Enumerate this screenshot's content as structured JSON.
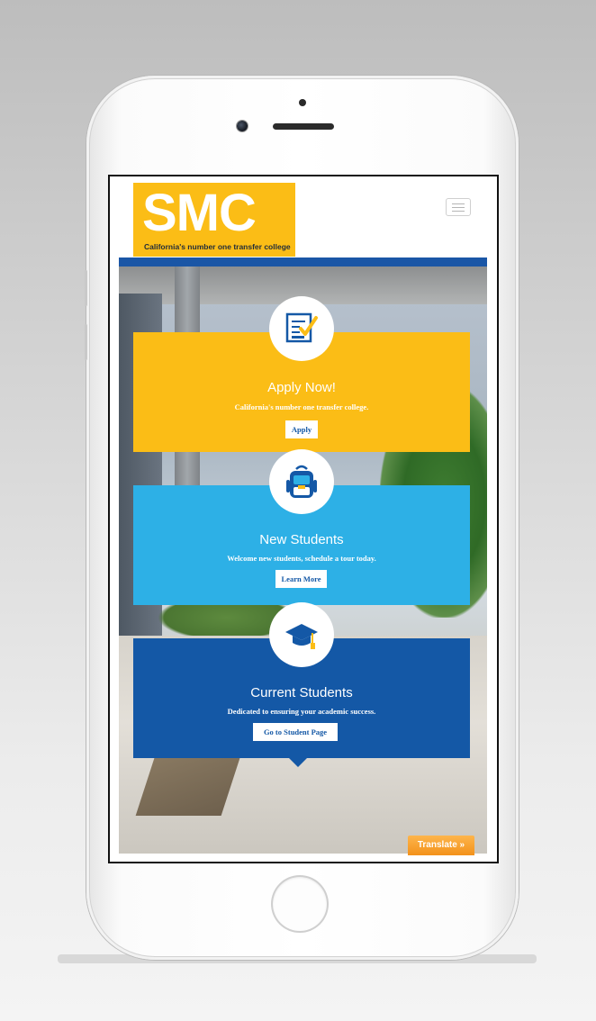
{
  "brand": {
    "logo_text": "SMC",
    "tagline": "California's number one transfer college",
    "logo_color": "#fbbd16"
  },
  "header": {
    "menu_icon": "hamburger-menu-icon"
  },
  "cards": [
    {
      "title": "Apply Now!",
      "subtitle": "California's number one transfer college.",
      "button": "Apply",
      "icon": "application-form-checkmark-icon",
      "color": "#fbbd16",
      "button_text_color": "#1458a6"
    },
    {
      "title": "New Students",
      "subtitle": "Welcome new students, schedule a tour today.",
      "button": "Learn More",
      "icon": "backpack-icon",
      "color": "#2db0e6",
      "button_text_color": "#1458a6"
    },
    {
      "title": "Current Students",
      "subtitle": "Dedicated to ensuring your academic success.",
      "button": "Go to Student Page",
      "icon": "graduation-cap-icon",
      "color": "#1458a6",
      "button_text_color": "#1458a6"
    }
  ],
  "translate": {
    "label": "Translate »",
    "color": "#f3921b"
  },
  "accent_bar_color": "#1a56a6"
}
